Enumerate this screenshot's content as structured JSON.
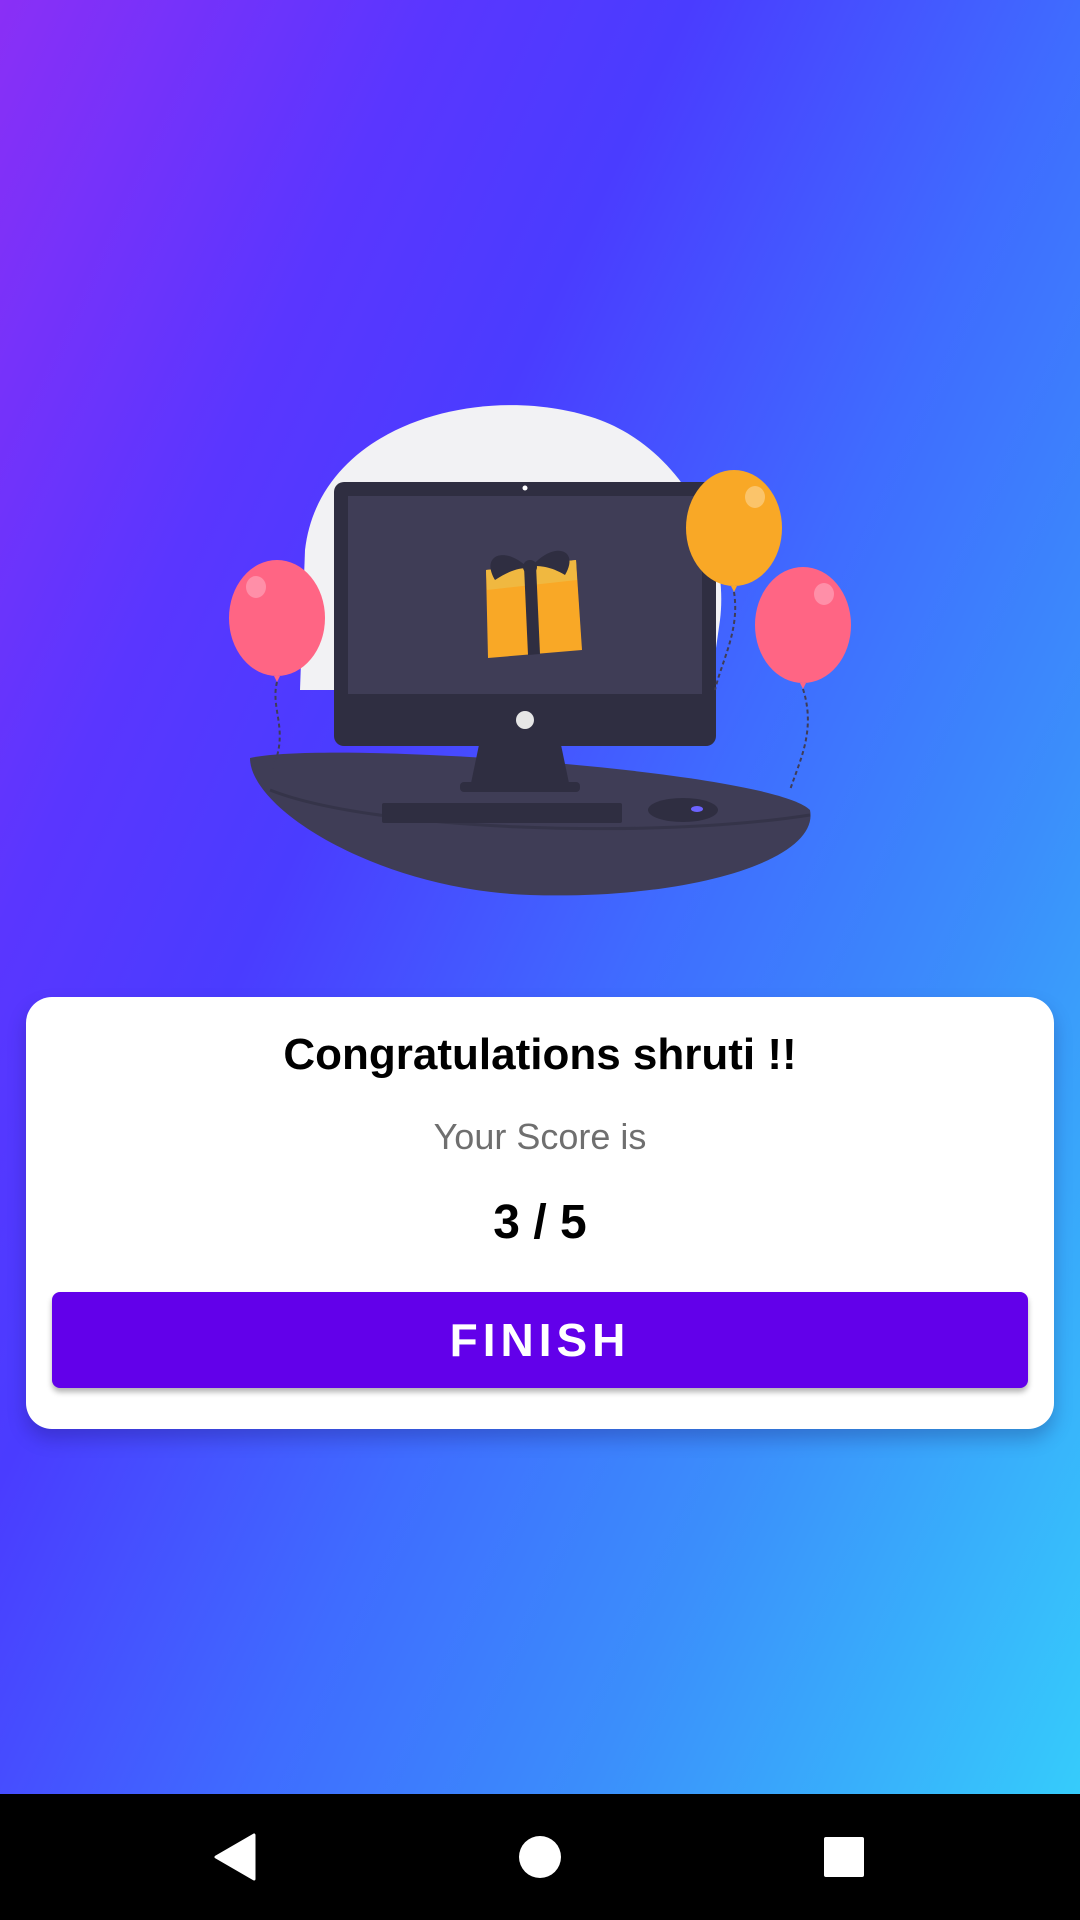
{
  "result": {
    "title": "Congratulations shruti !!",
    "subtitle": "Your Score is",
    "score": "3 / 5",
    "finish_label": "FINISH"
  },
  "colors": {
    "button": "#6200ea",
    "card": "#ffffff",
    "gradient_start": "#8a2ff6",
    "gradient_end": "#35d3fb"
  },
  "illustration": {
    "icons": [
      "computer-monitor-icon",
      "gift-box-icon",
      "balloon-icon",
      "keyboard-icon",
      "mouse-icon"
    ]
  },
  "navigation": {
    "buttons": [
      "back-icon",
      "home-icon",
      "recents-icon"
    ]
  }
}
